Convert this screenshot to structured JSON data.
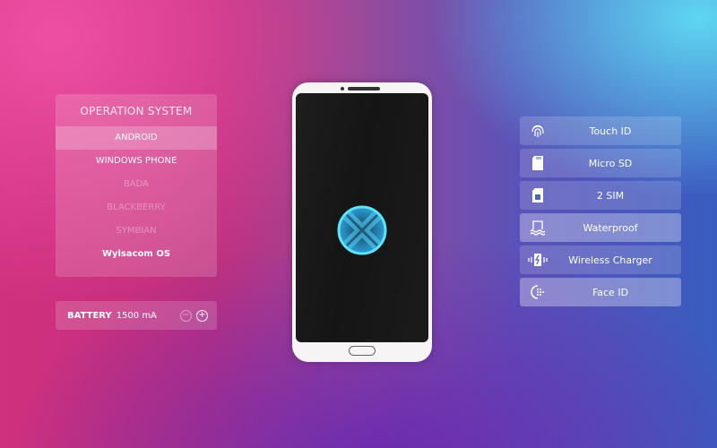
{
  "os_panel": {
    "title": "OPERATION SYSTEM",
    "items": [
      {
        "label": "ANDROID",
        "state": "selected"
      },
      {
        "label": "WINDOWS PHONE",
        "state": "normal"
      },
      {
        "label": "BADA",
        "state": "disabled"
      },
      {
        "label": "BLACKBERRY",
        "state": "disabled"
      },
      {
        "label": "SYMBIAN",
        "state": "disabled"
      },
      {
        "label": "Wylsacom OS",
        "state": "normal"
      }
    ]
  },
  "battery": {
    "label": "BATTERY",
    "value": "1500 mA",
    "minus": "−",
    "plus": "+"
  },
  "features": [
    {
      "label": "Touch ID",
      "icon": "fingerprint-icon",
      "active": false
    },
    {
      "label": "Micro SD",
      "icon": "sd-card-icon",
      "active": false
    },
    {
      "label": "2 SIM",
      "icon": "sim-card-icon",
      "active": false
    },
    {
      "label": "Waterproof",
      "icon": "waterproof-icon",
      "active": true
    },
    {
      "label": "Wireless Charger",
      "icon": "wireless-charger-icon",
      "active": false
    },
    {
      "label": "Face ID",
      "icon": "face-id-icon",
      "active": true
    }
  ],
  "colors": {
    "accent_logo": "#4fd8f0",
    "phone_body": "#f6f4f4",
    "screen": "#181818"
  }
}
